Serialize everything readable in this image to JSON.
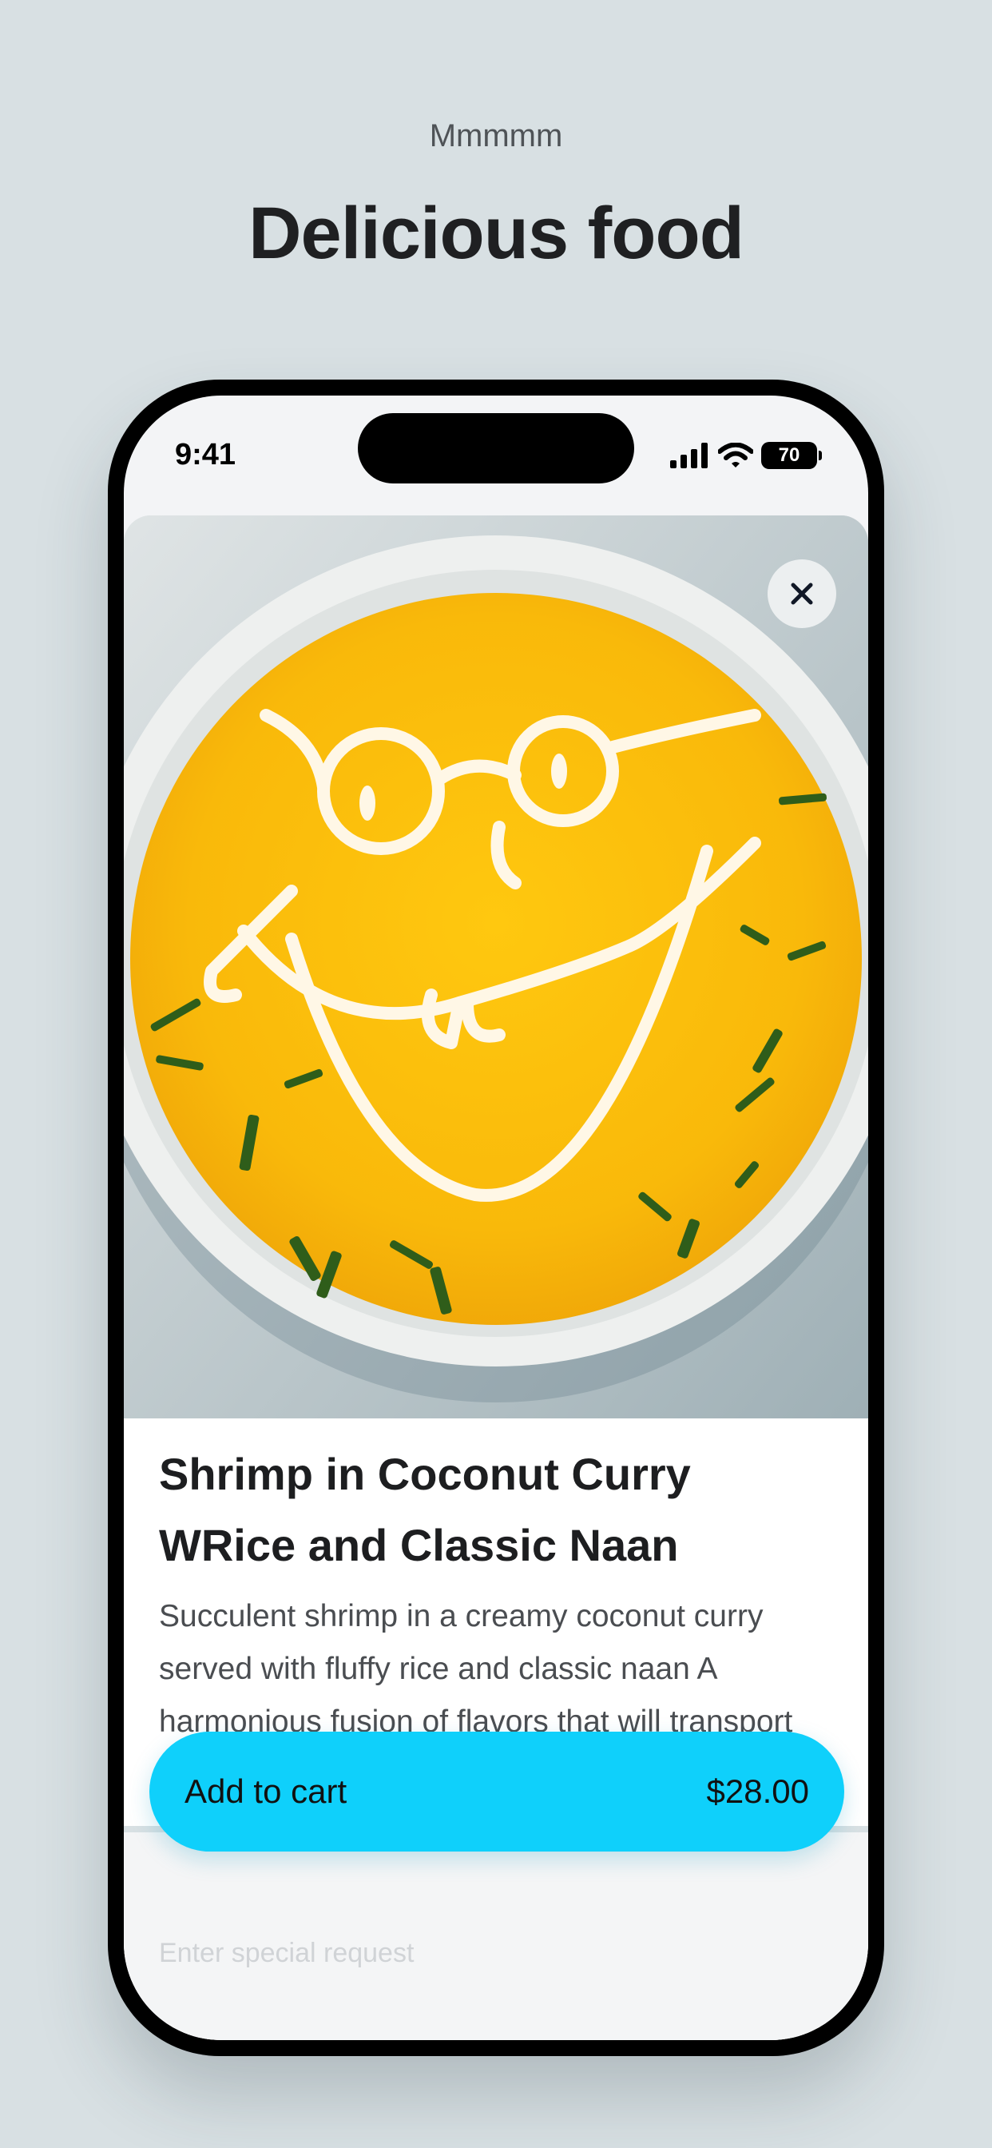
{
  "header": {
    "eyebrow": "Mmmmm",
    "title": "Delicious food"
  },
  "status_bar": {
    "time": "9:41",
    "battery_level": "70",
    "icons": [
      "signal-icon",
      "wifi-icon",
      "battery-icon"
    ]
  },
  "item": {
    "image_icon": "food-photo-soup-bowl",
    "title": "Shrimp in Coconut Curry WRice and Classic Naan",
    "description": "Succulent shrimp in a creamy coconut curry served with fluffy rice and classic naan A harmonious fusion of flavors that will transport your taste buds to the tropics"
  },
  "close_icon": "close-icon",
  "special_request": {
    "placeholder": "Enter special request"
  },
  "cart_button": {
    "label": "Add to cart",
    "price": "$28.00"
  },
  "colors": {
    "background": "#d8e0e3",
    "accent": "#0fd0fb",
    "soup": "#f7b70b"
  }
}
